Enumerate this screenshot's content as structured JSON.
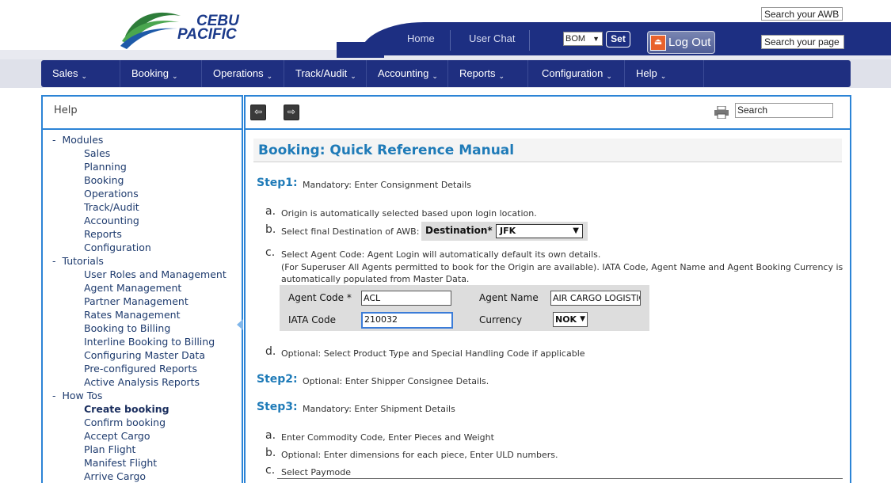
{
  "brand": {
    "line1": "CEBU",
    "line2": "PACIFIC",
    "colors": {
      "navy": "#1d2f82",
      "accent_blue": "#2c84d6",
      "title_blue": "#1f7bb8"
    }
  },
  "top": {
    "search_awb": "Search your AWB",
    "search_page": "Search your page",
    "home": "Home",
    "user_chat": "User Chat",
    "station": "BOM",
    "set": "Set",
    "logout": "Log Out",
    "logout_icon": "logout-icon"
  },
  "nav": [
    {
      "label": "Sales"
    },
    {
      "label": "Booking"
    },
    {
      "label": "Operations"
    },
    {
      "label": "Track/Audit"
    },
    {
      "label": "Accounting"
    },
    {
      "label": "Reports"
    },
    {
      "label": "Configuration"
    },
    {
      "label": "Help"
    }
  ],
  "sidebar": {
    "title": "Help",
    "modules": {
      "label": "Modules",
      "items": [
        "Sales",
        "Planning",
        "Booking",
        "Operations",
        "Track/Audit",
        "Accounting",
        "Reports",
        "Configuration"
      ]
    },
    "tutorials": {
      "label": "Tutorials",
      "items": [
        "User Roles and Management",
        "Agent Management",
        "Partner Management",
        "Rates Management",
        "Booking to Billing",
        "Interline Booking to Billing",
        "Configuring Master Data",
        "Pre-configured Reports",
        "Active Analysis Reports"
      ]
    },
    "howtos": {
      "label": "How Tos",
      "items": [
        "Create booking",
        "Confirm booking",
        "Accept Cargo",
        "Plan Flight",
        "Manifest Flight",
        "Arrive Cargo"
      ],
      "current": "Create booking"
    }
  },
  "help": {
    "search": "Search",
    "title": "Booking: Quick Reference Manual",
    "step1": {
      "label": "Step1:",
      "desc": "Mandatory: Enter Consignment Details"
    },
    "s1a": {
      "letter": "a.",
      "text": "Origin is automatically selected based upon login location."
    },
    "s1b": {
      "letter": "b.",
      "text": "Select final Destination of AWB:"
    },
    "destination": {
      "label": "Destination*",
      "value": "JFK"
    },
    "s1c": {
      "letter": "c.",
      "line1": "Select Agent Code: Agent Login will automatically default its own details.",
      "line2": "(For Superuser All Agents permitted to book for the Origin are available). IATA Code, Agent Name and Agent Booking Currency is",
      "line3": "automatically populated from Master Data."
    },
    "agent": {
      "agent_code_label": "Agent Code *",
      "agent_code": "ACL",
      "agent_name_label": "Agent Name",
      "agent_name": "AIR CARGO LOGISTIC",
      "iata_label": "IATA Code",
      "iata": "210032",
      "currency_label": "Currency",
      "currency": "NOK"
    },
    "s1d": {
      "letter": "d.",
      "text": "Optional: Select Product Type and Special Handling Code if applicable"
    },
    "step2": {
      "label": "Step2:",
      "desc": "Optional: Enter Shipper Consignee Details."
    },
    "step3": {
      "label": "Step3:",
      "desc": "Mandatory: Enter Shipment Details"
    },
    "s3a": {
      "letter": "a.",
      "text": "Enter Commodity Code, Enter Pieces and Weight"
    },
    "s3b": {
      "letter": "b.",
      "text": "Optional: Enter dimensions for each piece, Enter ULD numbers."
    },
    "s3c": {
      "letter": "c.",
      "text": "Select Paymode"
    }
  }
}
